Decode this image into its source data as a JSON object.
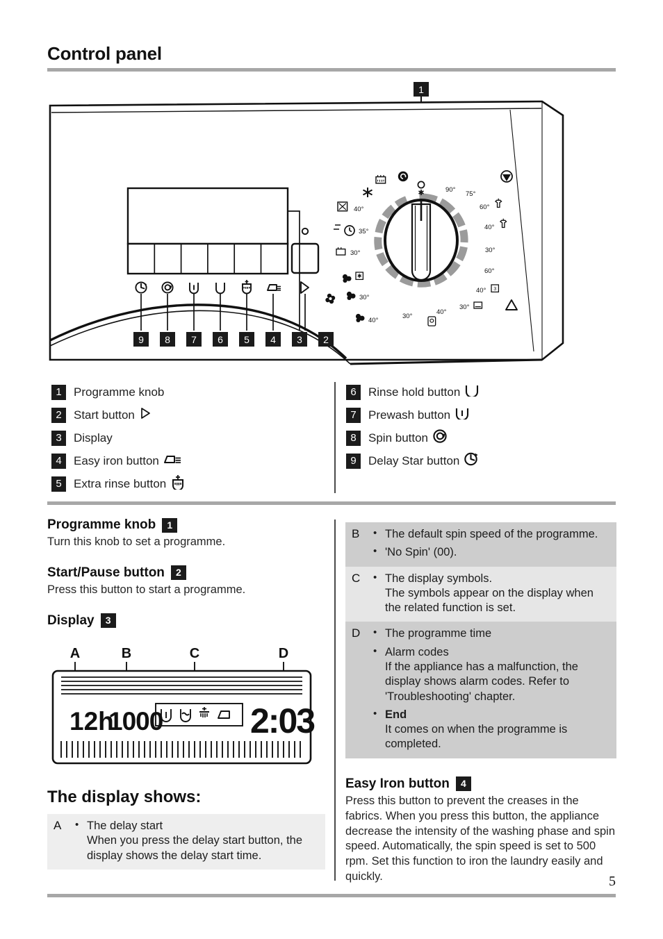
{
  "header": {
    "title": "Control panel"
  },
  "illustration": {
    "callouts_top": [
      "1"
    ],
    "callouts_bottom": [
      "9",
      "8",
      "7",
      "6",
      "5",
      "4",
      "3",
      "2"
    ],
    "dial_labels": [
      "90°",
      "75°",
      "60°",
      "40°",
      "30°",
      "60°",
      "40°",
      "30°",
      "40°",
      "30°",
      "30°",
      "35°",
      "40°",
      "30°"
    ],
    "button_icons": [
      "delay-start-icon",
      "spin-icon",
      "prewash-icon",
      "rinse-hold-icon",
      "extra-rinse-icon",
      "easy-iron-icon"
    ],
    "start_icon": "play-triangle-icon"
  },
  "legend": {
    "left": [
      {
        "num": "1",
        "label": "Programme knob",
        "icon": ""
      },
      {
        "num": "2",
        "label": "Start button",
        "icon": "play-triangle-icon"
      },
      {
        "num": "3",
        "label": "Display",
        "icon": ""
      },
      {
        "num": "4",
        "label": "Easy iron button",
        "icon": "iron-icon"
      },
      {
        "num": "5",
        "label": "Extra rinse button",
        "icon": "extra-rinse-icon"
      }
    ],
    "right": [
      {
        "num": "6",
        "label": "Rinse hold button",
        "icon": "rinse-hold-icon"
      },
      {
        "num": "7",
        "label": "Prewash button",
        "icon": "prewash-icon"
      },
      {
        "num": "8",
        "label": "Spin button",
        "icon": "spin-spiral-icon"
      },
      {
        "num": "9",
        "label": "Delay Star button",
        "icon": "clock-arrow-icon"
      }
    ]
  },
  "left_column": {
    "sections": [
      {
        "title": "Programme knob",
        "badge": "1",
        "body": "Turn this knob to set a programme."
      },
      {
        "title": "Start/Pause button",
        "badge": "2",
        "body": "Press this button to start a programme."
      },
      {
        "title": "Display",
        "badge": "3",
        "body": ""
      }
    ],
    "display_markers": [
      "A",
      "B",
      "C",
      "D"
    ],
    "lcd": {
      "delay_value": "12h",
      "spin_value": "1000",
      "time_value": "2:03",
      "symbols": [
        "prewash-icon",
        "rinse-hold-icon",
        "extra-rinse-icon",
        "easy-iron-icon"
      ]
    },
    "display_shows_heading": "The display shows:",
    "table": [
      {
        "key": "A",
        "shade": "light",
        "bullets": [
          {
            "main": "The delay start",
            "sub": "When you press the delay start button, the display shows the delay start time."
          }
        ]
      }
    ]
  },
  "right_column": {
    "table": [
      {
        "key": "B",
        "shade": "dark",
        "bullets": [
          {
            "main": "The default spin speed of the programme.",
            "sub": ""
          },
          {
            "main": "'No Spin' (00).",
            "sub": ""
          }
        ]
      },
      {
        "key": "C",
        "shade": "light",
        "bullets": [
          {
            "main": "The display symbols.",
            "sub": "The symbols appear on the display when the related function is set."
          }
        ]
      },
      {
        "key": "D",
        "shade": "dark",
        "bullets": [
          {
            "main": "The programme time",
            "sub": ""
          },
          {
            "main": "Alarm codes",
            "sub": "If the appliance has a malfunction, the display shows alarm codes. Refer to 'Troubleshooting' chapter."
          },
          {
            "main": "End",
            "sub": "It comes on when the programme is completed.",
            "bold": true
          }
        ]
      }
    ],
    "section": {
      "title": "Easy Iron button",
      "badge": "4",
      "body": "Press this button to prevent the creases in the fabrics. When you press this button, the appliance decrease the intensity of the washing phase and spin speed. Automatically, the spin speed is set to 500 rpm. Set this function to iron the laundry easily and quickly."
    }
  },
  "footer": {
    "page_number": "5"
  }
}
